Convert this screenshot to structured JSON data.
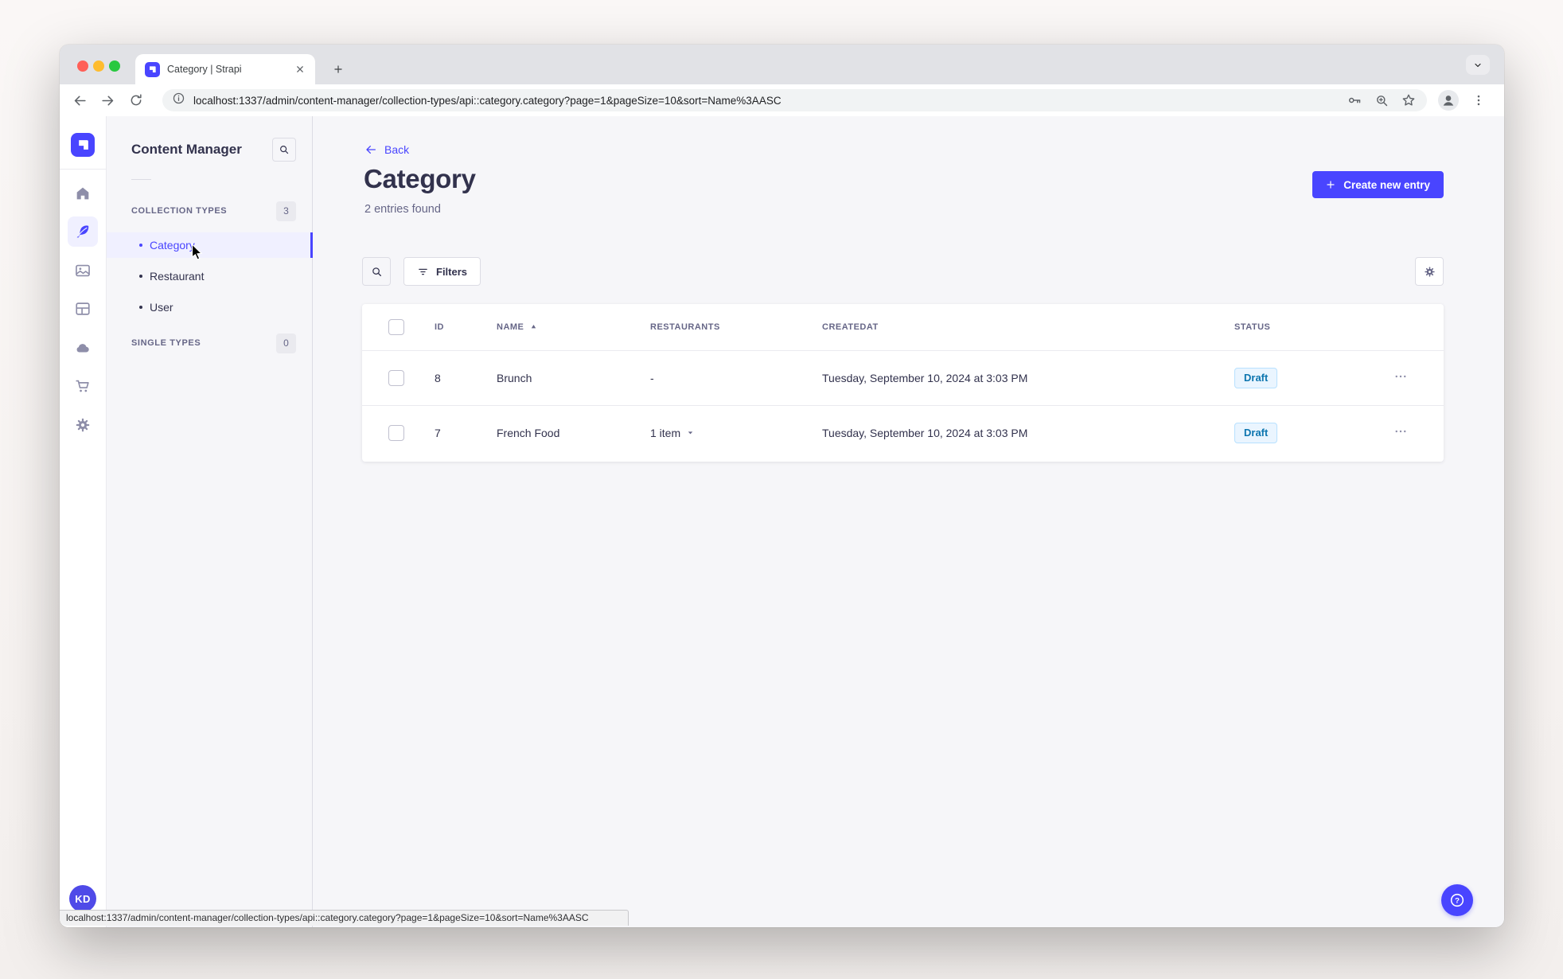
{
  "window": {
    "tab_title": "Category | Strapi",
    "url": "localhost:1337/admin/content-manager/collection-types/api::category.category?page=1&pageSize=10&sort=Name%3AASC",
    "status_bar_url": "localhost:1337/admin/content-manager/collection-types/api::category.category?page=1&pageSize=10&sort=Name%3AASC"
  },
  "rail": {
    "logo_icon": "strapi-logo",
    "icons": [
      "home-icon",
      "content-manager-icon",
      "media-library-icon",
      "content-type-builder-icon",
      "cloud-icon",
      "marketplace-icon",
      "settings-icon"
    ],
    "avatar_initials": "KD"
  },
  "subnav": {
    "title": "Content Manager",
    "search_icon": "search-icon",
    "collection_types": {
      "label": "COLLECTION TYPES",
      "count": "3",
      "items": [
        {
          "label": "Category",
          "active": true
        },
        {
          "label": "Restaurant",
          "active": false
        },
        {
          "label": "User",
          "active": false
        }
      ]
    },
    "single_types": {
      "label": "SINGLE TYPES",
      "count": "0"
    }
  },
  "content": {
    "back_label": "Back",
    "title": "Category",
    "subtitle": "2 entries found",
    "create_button_label": "Create new entry",
    "filters_button_label": "Filters"
  },
  "table": {
    "headers": {
      "id": "ID",
      "name": "NAME",
      "restaurants": "RESTAURANTS",
      "createdat": "CREATEDAT",
      "status": "STATUS"
    },
    "sort": {
      "column": "NAME",
      "direction": "ascending"
    },
    "rows": [
      {
        "id": "8",
        "name": "Brunch",
        "restaurants": "-",
        "createdat": "Tuesday, September 10, 2024 at 3:03 PM",
        "status": "Draft"
      },
      {
        "id": "7",
        "name": "French Food",
        "restaurants": "1 item",
        "createdat": "Tuesday, September 10, 2024 at 3:03 PM",
        "status": "Draft"
      }
    ]
  },
  "colors": {
    "primary": "#4945ff",
    "text_dark": "#32324d",
    "text_muted": "#666687",
    "selected_bg": "#f0f0ff",
    "app_bg": "#f6f6f9",
    "draft_bg": "#eaf5ff",
    "draft_border": "#b8e1ff",
    "draft_text": "#0c75af"
  }
}
